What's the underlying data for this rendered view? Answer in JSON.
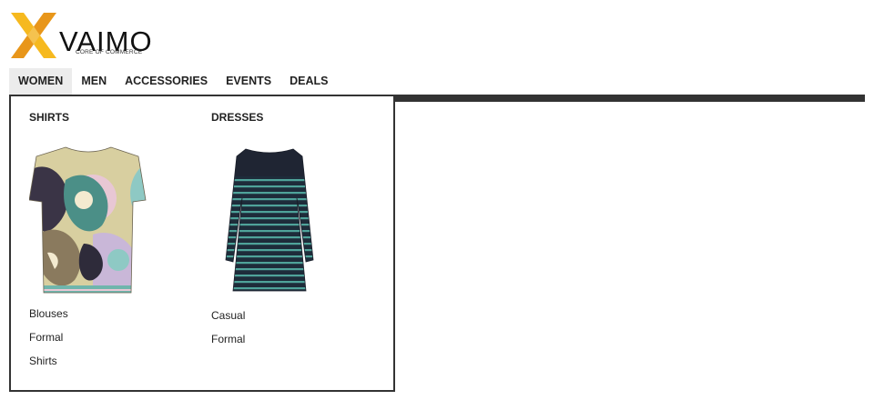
{
  "brand": {
    "name": "VAIMO",
    "tagline": "CORE OF COMMERCE",
    "colors": {
      "accent_light": "#f9c238",
      "accent_dark": "#e8961a"
    }
  },
  "nav": {
    "items": [
      {
        "label": "WOMEN",
        "active": true
      },
      {
        "label": "MEN",
        "active": false
      },
      {
        "label": "ACCESSORIES",
        "active": false
      },
      {
        "label": "EVENTS",
        "active": false
      },
      {
        "label": "DEALS",
        "active": false
      }
    ]
  },
  "menu": {
    "columns": [
      {
        "heading": "SHIRTS",
        "image": "patterned-shirt-image",
        "links": [
          "Blouses",
          "Formal",
          "Shirts"
        ]
      },
      {
        "heading": "DRESSES",
        "image": "striped-dress-image",
        "links": [
          "Casual",
          "Formal"
        ]
      }
    ]
  }
}
